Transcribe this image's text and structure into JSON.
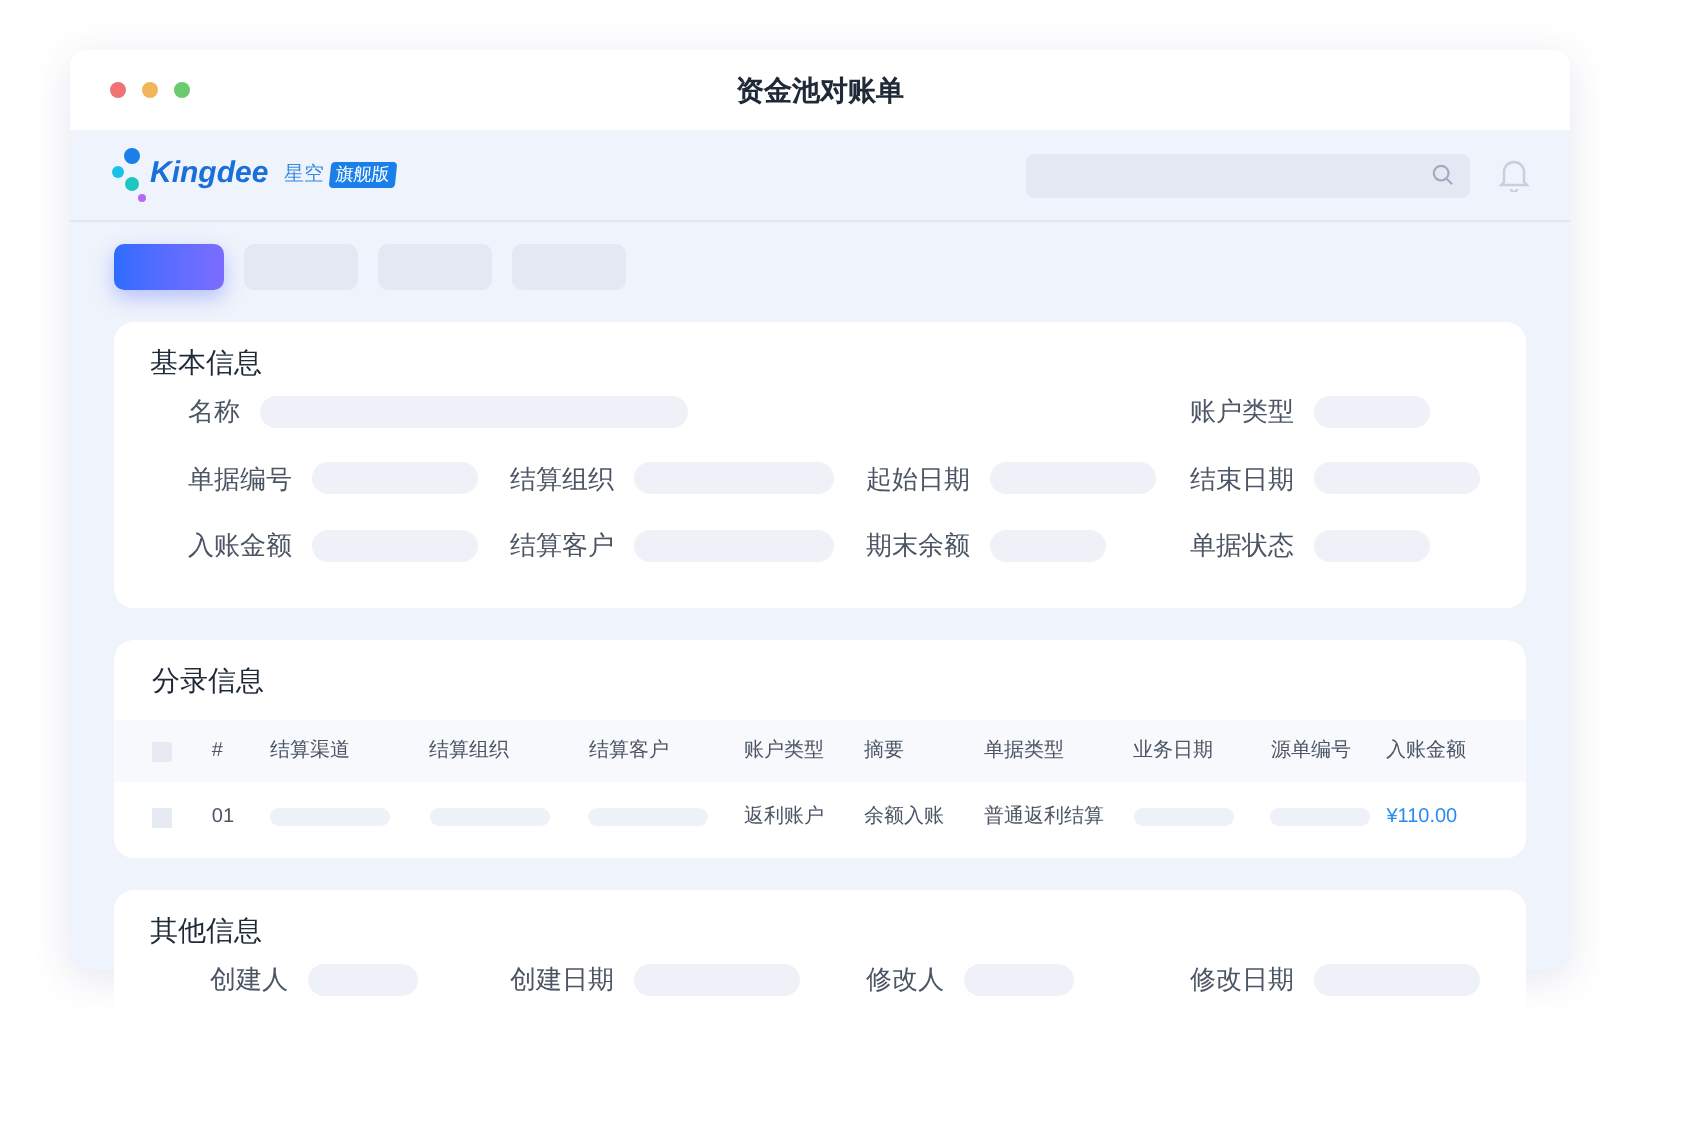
{
  "window": {
    "title": "资金池对账单"
  },
  "brand": {
    "name": "Kingdee",
    "product": "星空",
    "edition": "旗舰版"
  },
  "toolbar_buttons": [
    {
      "selected": true
    },
    {
      "selected": false
    },
    {
      "selected": false
    },
    {
      "selected": false
    }
  ],
  "basic_info": {
    "title": "基本信息",
    "fields": [
      {
        "label": "名称"
      },
      {
        "label": "账户类型"
      },
      {
        "label": "单据编号"
      },
      {
        "label": "结算组织"
      },
      {
        "label": "起始日期"
      },
      {
        "label": "结束日期"
      },
      {
        "label": "入账金额"
      },
      {
        "label": "结算客户"
      },
      {
        "label": "期末余额"
      },
      {
        "label": "单据状态"
      }
    ]
  },
  "entries": {
    "title": "分录信息",
    "header_checked": false,
    "columns": [
      "#",
      "结算渠道",
      "结算组织",
      "结算客户",
      "账户类型",
      "摘要",
      "单据类型",
      "业务日期",
      "源单编号",
      "入账金额"
    ],
    "rows": [
      {
        "checked": false,
        "cells": [
          {
            "kind": "text",
            "text": "01"
          },
          {
            "kind": "blank"
          },
          {
            "kind": "blank"
          },
          {
            "kind": "blank"
          },
          {
            "kind": "text",
            "text": "返利账户"
          },
          {
            "kind": "text",
            "text": "余额入账"
          },
          {
            "kind": "text",
            "text": "普通返利结算"
          },
          {
            "kind": "blank"
          },
          {
            "kind": "blank"
          },
          {
            "kind": "amount",
            "text": "¥110.00"
          }
        ]
      }
    ]
  },
  "other_info": {
    "title": "其他信息",
    "fields": [
      {
        "label": "创建人"
      },
      {
        "label": "创建日期"
      },
      {
        "label": "修改人"
      },
      {
        "label": "修改日期"
      }
    ]
  }
}
